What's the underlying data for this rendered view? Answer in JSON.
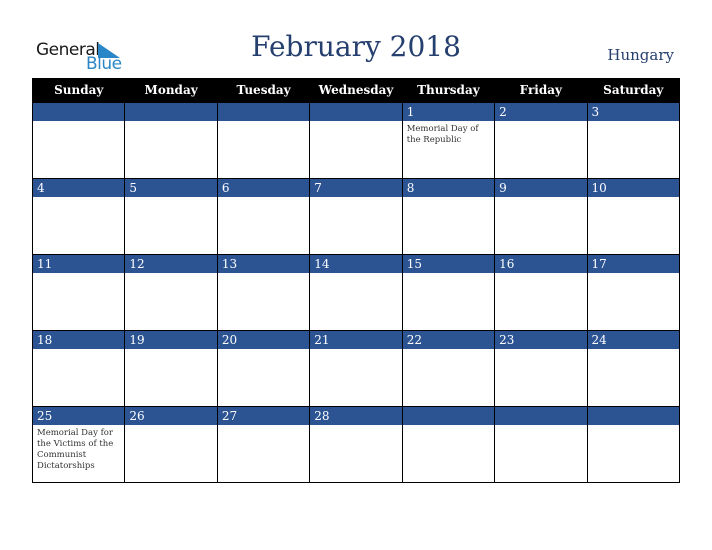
{
  "logo": {
    "word1": "General",
    "word2": "Blue"
  },
  "header": {
    "title": "February 2018",
    "country": "Hungary"
  },
  "colors": {
    "band": "#2c5493",
    "header_bg": "#000000",
    "title": "#253f6e",
    "logo_blue": "#2a86c6"
  },
  "weekdays": [
    "Sunday",
    "Monday",
    "Tuesday",
    "Wednesday",
    "Thursday",
    "Friday",
    "Saturday"
  ],
  "weeks": [
    [
      {
        "day": "",
        "holiday": ""
      },
      {
        "day": "",
        "holiday": ""
      },
      {
        "day": "",
        "holiday": ""
      },
      {
        "day": "",
        "holiday": ""
      },
      {
        "day": "1",
        "holiday": "Memorial Day of the Republic"
      },
      {
        "day": "2",
        "holiday": ""
      },
      {
        "day": "3",
        "holiday": ""
      }
    ],
    [
      {
        "day": "4",
        "holiday": ""
      },
      {
        "day": "5",
        "holiday": ""
      },
      {
        "day": "6",
        "holiday": ""
      },
      {
        "day": "7",
        "holiday": ""
      },
      {
        "day": "8",
        "holiday": ""
      },
      {
        "day": "9",
        "holiday": ""
      },
      {
        "day": "10",
        "holiday": ""
      }
    ],
    [
      {
        "day": "11",
        "holiday": ""
      },
      {
        "day": "12",
        "holiday": ""
      },
      {
        "day": "13",
        "holiday": ""
      },
      {
        "day": "14",
        "holiday": ""
      },
      {
        "day": "15",
        "holiday": ""
      },
      {
        "day": "16",
        "holiday": ""
      },
      {
        "day": "17",
        "holiday": ""
      }
    ],
    [
      {
        "day": "18",
        "holiday": ""
      },
      {
        "day": "19",
        "holiday": ""
      },
      {
        "day": "20",
        "holiday": ""
      },
      {
        "day": "21",
        "holiday": ""
      },
      {
        "day": "22",
        "holiday": ""
      },
      {
        "day": "23",
        "holiday": ""
      },
      {
        "day": "24",
        "holiday": ""
      }
    ],
    [
      {
        "day": "25",
        "holiday": "Memorial Day for the Victims of the Communist Dictatorships"
      },
      {
        "day": "26",
        "holiday": ""
      },
      {
        "day": "27",
        "holiday": ""
      },
      {
        "day": "28",
        "holiday": ""
      },
      {
        "day": "",
        "holiday": ""
      },
      {
        "day": "",
        "holiday": ""
      },
      {
        "day": "",
        "holiday": ""
      }
    ]
  ]
}
